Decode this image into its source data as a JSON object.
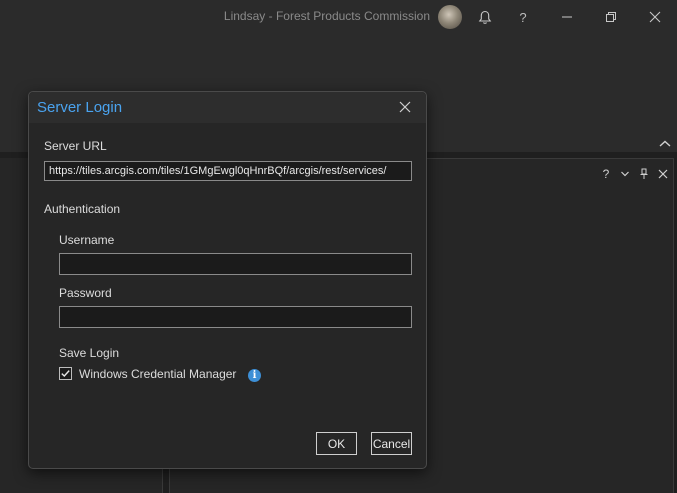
{
  "titlebar": {
    "user_text": "Lindsay - Forest Products Commission",
    "avatar_icon": "user-avatar",
    "notifications_icon": "bell-icon",
    "help_label": "?",
    "minimize_icon": "minimize-icon",
    "restore_icon": "restore-icon",
    "close_icon": "close-icon"
  },
  "pane": {
    "help_label": "?",
    "menu_icon": "chevron-down-icon",
    "pin_icon": "pin-icon",
    "close_icon": "close-icon"
  },
  "dialog": {
    "title": "Server Login",
    "server_url_label": "Server URL",
    "server_url_value": "https://tiles.arcgis.com/tiles/1GMgEwgl0qHnrBQf/arcgis/rest/services/",
    "authentication_label": "Authentication",
    "username_label": "Username",
    "username_value": "",
    "password_label": "Password",
    "password_value": "",
    "save_login_label": "Save Login",
    "credential_manager_label": "Windows Credential Manager",
    "credential_manager_checked": true,
    "info_glyph": "i",
    "ok_label": "OK",
    "cancel_label": "Cancel"
  },
  "colors": {
    "accent": "#4aa3ef",
    "info": "#3d8fd6",
    "background": "#1f1f1f",
    "dialog_background": "#262626"
  }
}
